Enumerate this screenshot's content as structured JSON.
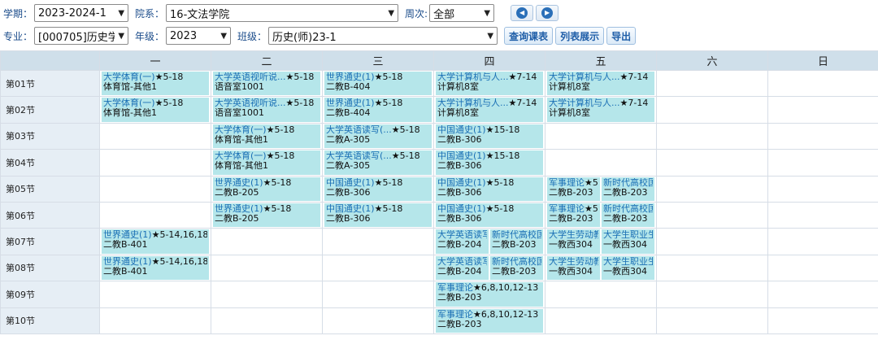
{
  "filters": {
    "term_label": "学期：",
    "term_value": "2023-2024-1",
    "dept_label": "院系：",
    "dept_value": "16-文法学院",
    "week_label": "周次:",
    "week_value": "全部",
    "major_label": "专业：",
    "major_value": "[000705]历史学(",
    "grade_label": "年级：",
    "grade_value": "2023",
    "class_label": "班级：",
    "class_value": "历史(师)23-1",
    "prev_icon": "◀",
    "next_icon": "▶",
    "query_btn": "查询课表",
    "list_btn": "列表展示",
    "export_btn": "导出"
  },
  "colors": {
    "header_bg": "#cfdfea",
    "period_bg": "#e6eef5",
    "course_bg": "#b5e6ea",
    "course_name": "#1a6fb5"
  },
  "schedule": {
    "days": [
      "一",
      "二",
      "三",
      "四",
      "五",
      "六",
      "日"
    ],
    "rows": [
      {
        "period": "第01节",
        "cells": [
          [
            {
              "name": "大学体育(一)",
              "weeks": "★5-18",
              "room": "体育馆-其他1"
            }
          ],
          [
            {
              "name": "大学英语视听说...",
              "weeks": "★5-18",
              "room": "语音室1001"
            }
          ],
          [
            {
              "name": "世界通史(1)",
              "weeks": "★5-18",
              "room": "二教B-404"
            }
          ],
          [
            {
              "name": "大学计算机与人...",
              "weeks": "★7-14",
              "room": "计算机8室"
            }
          ],
          [
            {
              "name": "大学计算机与人...",
              "weeks": "★7-14",
              "room": "计算机8室"
            }
          ],
          [],
          []
        ]
      },
      {
        "period": "第02节",
        "cells": [
          [
            {
              "name": "大学体育(一)",
              "weeks": "★5-18",
              "room": "体育馆-其他1"
            }
          ],
          [
            {
              "name": "大学英语视听说...",
              "weeks": "★5-18",
              "room": "语音室1001"
            }
          ],
          [
            {
              "name": "世界通史(1)",
              "weeks": "★5-18",
              "room": "二教B-404"
            }
          ],
          [
            {
              "name": "大学计算机与人...",
              "weeks": "★7-14",
              "room": "计算机8室"
            }
          ],
          [
            {
              "name": "大学计算机与人...",
              "weeks": "★7-14",
              "room": "计算机8室"
            }
          ],
          [],
          []
        ]
      },
      {
        "period": "第03节",
        "cells": [
          [],
          [
            {
              "name": "大学体育(一)",
              "weeks": "★5-18",
              "room": "体育馆-其他1"
            }
          ],
          [
            {
              "name": "大学英语读写(...",
              "weeks": "★5-18",
              "room": "二教A-305"
            }
          ],
          [
            {
              "name": "中国通史(1)",
              "weeks": "★15-18",
              "room": "二教B-306"
            }
          ],
          [],
          [],
          []
        ]
      },
      {
        "period": "第04节",
        "cells": [
          [],
          [
            {
              "name": "大学体育(一)",
              "weeks": "★5-18",
              "room": "体育馆-其他1"
            }
          ],
          [
            {
              "name": "大学英语读写(...",
              "weeks": "★5-18",
              "room": "二教A-305"
            }
          ],
          [
            {
              "name": "中国通史(1)",
              "weeks": "★15-18",
              "room": "二教B-306"
            }
          ],
          [],
          [],
          []
        ]
      },
      {
        "period": "第05节",
        "cells": [
          [],
          [
            {
              "name": "世界通史(1)",
              "weeks": "★5-18",
              "room": "二教B-205"
            }
          ],
          [
            {
              "name": "中国通史(1)",
              "weeks": "★5-18",
              "room": "二教B-306"
            }
          ],
          [
            {
              "name": "中国通史(1)",
              "weeks": "★5-18",
              "room": "二教B-306"
            }
          ],
          [
            {
              "name": "军事理论",
              "weeks": "★5",
              "room": "二教B-203"
            },
            {
              "name": "新时代高校国",
              "weeks": "",
              "room": "二教B-203"
            }
          ],
          [],
          []
        ]
      },
      {
        "period": "第06节",
        "cells": [
          [],
          [
            {
              "name": "世界通史(1)",
              "weeks": "★5-18",
              "room": "二教B-205"
            }
          ],
          [
            {
              "name": "中国通史(1)",
              "weeks": "★5-18",
              "room": "二教B-306"
            }
          ],
          [
            {
              "name": "中国通史(1)",
              "weeks": "★5-18",
              "room": "二教B-306"
            }
          ],
          [
            {
              "name": "军事理论",
              "weeks": "★5",
              "room": "二教B-203"
            },
            {
              "name": "新时代高校国",
              "weeks": "",
              "room": "二教B-203"
            }
          ],
          [],
          []
        ]
      },
      {
        "period": "第07节",
        "cells": [
          [
            {
              "name": "世界通史(1)",
              "weeks": "★5-14,16,18",
              "room": "二教B-401"
            }
          ],
          [],
          [],
          [
            {
              "name": "大学英语读写",
              "weeks": "",
              "room": "二教B-204"
            },
            {
              "name": "新时代高校国",
              "weeks": "",
              "room": "二教B-203"
            }
          ],
          [
            {
              "name": "大学生劳动教",
              "weeks": "",
              "room": "一教西304"
            },
            {
              "name": "大学生职业生",
              "weeks": "",
              "room": "一教西304"
            }
          ],
          [],
          []
        ]
      },
      {
        "period": "第08节",
        "cells": [
          [
            {
              "name": "世界通史(1)",
              "weeks": "★5-14,16,18",
              "room": "二教B-401"
            }
          ],
          [],
          [],
          [
            {
              "name": "大学英语读写",
              "weeks": "",
              "room": "二教B-204"
            },
            {
              "name": "新时代高校国",
              "weeks": "",
              "room": "二教B-203"
            }
          ],
          [
            {
              "name": "大学生劳动教",
              "weeks": "",
              "room": "一教西304"
            },
            {
              "name": "大学生职业生",
              "weeks": "",
              "room": "一教西304"
            }
          ],
          [],
          []
        ]
      },
      {
        "period": "第09节",
        "cells": [
          [],
          [],
          [],
          [
            {
              "name": "军事理论",
              "weeks": "★6,8,10,12-13",
              "room": "二教B-203"
            }
          ],
          [],
          [],
          []
        ]
      },
      {
        "period": "第10节",
        "cells": [
          [],
          [],
          [],
          [
            {
              "name": "军事理论",
              "weeks": "★6,8,10,12-13",
              "room": "二教B-203"
            }
          ],
          [],
          [],
          []
        ]
      }
    ]
  }
}
